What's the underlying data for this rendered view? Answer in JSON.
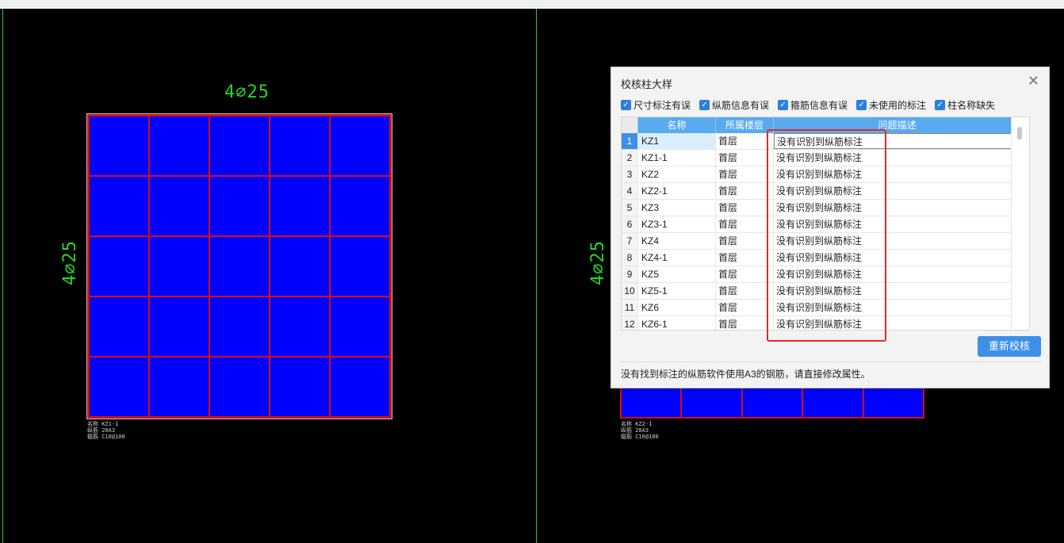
{
  "cad": {
    "left_panel": {
      "top_label": "4⌀25",
      "side_label": "4⌀25",
      "info_lines": [
        "名称  KZ1-1",
        "纵筋  20A3",
        "箍筋  C10@100"
      ]
    },
    "right_panel": {
      "side_label": "4⌀25",
      "info_lines": [
        "名称  KZ2-1",
        "纵筋  20A3",
        "箍筋  C10@100"
      ]
    }
  },
  "dialog": {
    "title": "校核柱大样",
    "close_icon": "close-icon",
    "filters": [
      {
        "label": "尺寸标注有误",
        "checked": true
      },
      {
        "label": "纵筋信息有误",
        "checked": true
      },
      {
        "label": "箍筋信息有误",
        "checked": true
      },
      {
        "label": "未使用的标注",
        "checked": true
      },
      {
        "label": "柱名称缺失",
        "checked": true
      }
    ],
    "table": {
      "headers": [
        "名称",
        "所属楼层",
        "问题描述"
      ],
      "rows": [
        {
          "idx": "1",
          "name": "KZ1",
          "floor": "首层",
          "desc": "没有识别到纵筋标注"
        },
        {
          "idx": "2",
          "name": "KZ1-1",
          "floor": "首层",
          "desc": "没有识别到纵筋标注"
        },
        {
          "idx": "3",
          "name": "KZ2",
          "floor": "首层",
          "desc": "没有识别到纵筋标注"
        },
        {
          "idx": "4",
          "name": "KZ2-1",
          "floor": "首层",
          "desc": "没有识别到纵筋标注"
        },
        {
          "idx": "5",
          "name": "KZ3",
          "floor": "首层",
          "desc": "没有识别到纵筋标注"
        },
        {
          "idx": "6",
          "name": "KZ3-1",
          "floor": "首层",
          "desc": "没有识别到纵筋标注"
        },
        {
          "idx": "7",
          "name": "KZ4",
          "floor": "首层",
          "desc": "没有识别到纵筋标注"
        },
        {
          "idx": "8",
          "name": "KZ4-1",
          "floor": "首层",
          "desc": "没有识别到纵筋标注"
        },
        {
          "idx": "9",
          "name": "KZ5",
          "floor": "首层",
          "desc": "没有识别到纵筋标注"
        },
        {
          "idx": "10",
          "name": "KZ5-1",
          "floor": "首层",
          "desc": "没有识别到纵筋标注"
        },
        {
          "idx": "11",
          "name": "KZ6",
          "floor": "首层",
          "desc": "没有识别到纵筋标注"
        },
        {
          "idx": "12",
          "name": "KZ6-1",
          "floor": "首层",
          "desc": "没有识别到纵筋标注"
        }
      ]
    },
    "recheck_button": "重新校核",
    "hint": "没有找到标注的纵筋软件使用A3的钢筋，请直接修改属性。"
  },
  "colors": {
    "cad_bg": "#000000",
    "cad_green": "#22d822",
    "cell_blue": "#0000ff",
    "grid_red": "#d01010",
    "accent": "#3d8fe8",
    "highlight": "#e12a2a"
  }
}
